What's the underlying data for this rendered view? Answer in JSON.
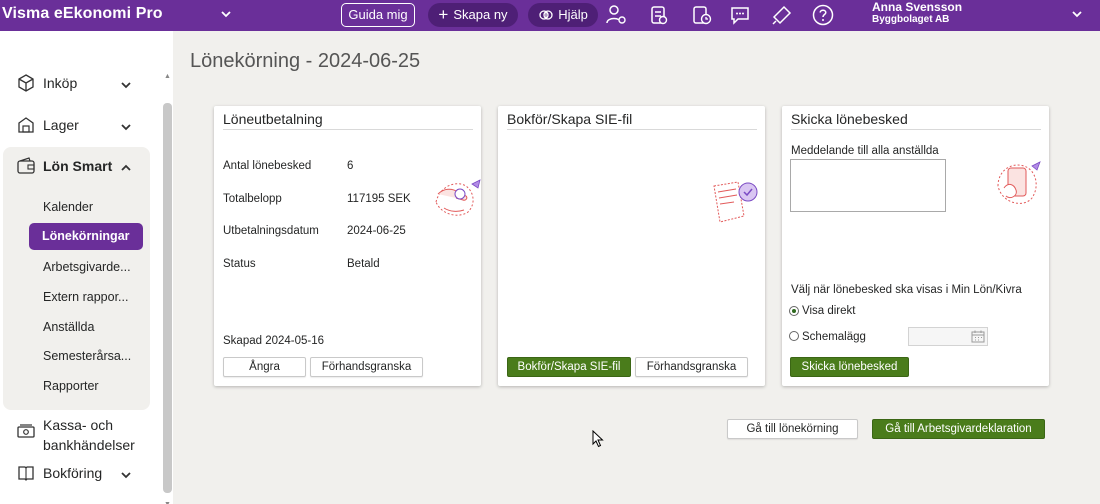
{
  "app": {
    "title": "Visma eEkonomi Pro"
  },
  "topbar": {
    "guida_label": "Guida mig",
    "skapa_label": "Skapa ny",
    "hjalp_label": "Hjälp",
    "user_name": "Anna Svensson",
    "user_company": "Byggbolaget AB"
  },
  "sidebar": {
    "items": [
      {
        "label": "Inköp"
      },
      {
        "label": "Lager"
      },
      {
        "label": "Lön Smart"
      },
      {
        "label": "Kassa- och"
      },
      {
        "label": "bankhändelser"
      },
      {
        "label": "Bokföring"
      }
    ],
    "sub_items": [
      {
        "label": "Kalender"
      },
      {
        "label": "Lönekörningar"
      },
      {
        "label": "Arbetsgivarde..."
      },
      {
        "label": "Extern rappor..."
      },
      {
        "label": "Anställda"
      },
      {
        "label": "Semesterårsa..."
      },
      {
        "label": "Rapporter"
      }
    ]
  },
  "page": {
    "title": "Lönekörning - 2024-06-25"
  },
  "card_payout": {
    "title": "Löneutbetalning",
    "rows": [
      {
        "label": "Antal lönebesked",
        "value": "6"
      },
      {
        "label": "Totalbelopp",
        "value": "117195 SEK"
      },
      {
        "label": "Utbetalningsdatum",
        "value": "2024-06-25"
      },
      {
        "label": "Status",
        "value": "Betald"
      }
    ],
    "created": "Skapad 2024-05-16",
    "undo_label": "Ångra",
    "preview_label": "Förhandsgranska"
  },
  "card_sie": {
    "title": "Bokför/Skapa SIE-fil",
    "primary_label": "Bokför/Skapa SIE-fil",
    "preview_label": "Förhandsgranska"
  },
  "card_send": {
    "title": "Skicka lönebesked",
    "message_label": "Meddelande till alla anställda",
    "message_value": "",
    "visibility_label": "Välj när lönebesked ska visas i Min Lön/Kivra",
    "option_direct": "Visa direkt",
    "option_schedule": "Schemalägg",
    "date_value": "",
    "send_label": "Skicka lönebesked"
  },
  "footer": {
    "goto_run_label": "Gå till lönekörning",
    "goto_agd_label": "Gå till Arbetsgivardeklaration"
  },
  "colors": {
    "brand_purple": "#6a2f99",
    "primary_green": "#4a7c1b",
    "background": "#f1f0ed"
  }
}
